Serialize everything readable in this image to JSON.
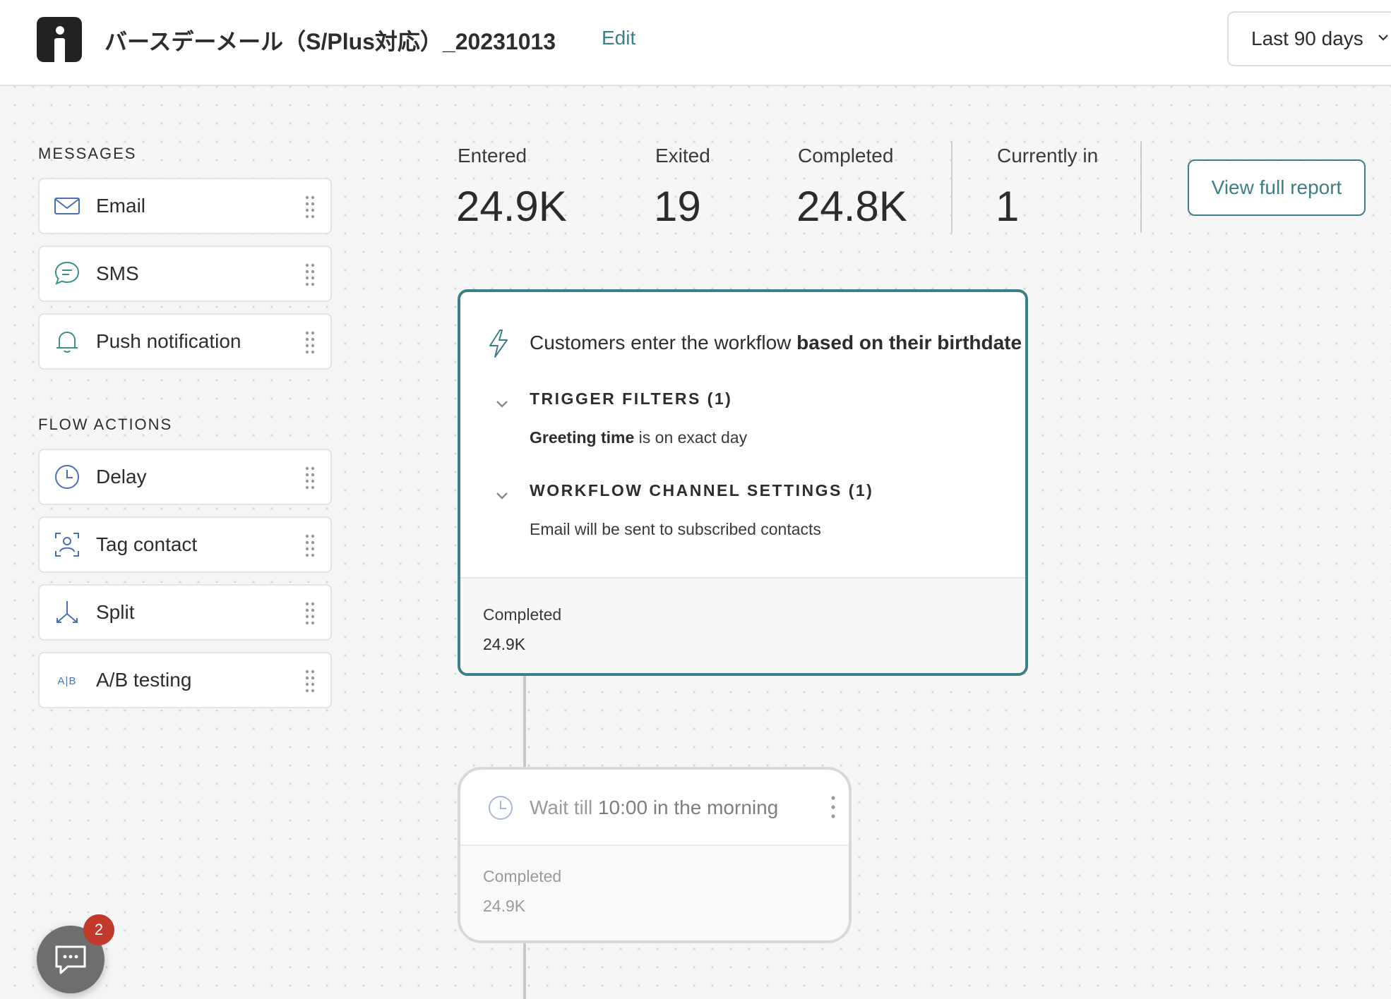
{
  "header": {
    "title": "バースデーメール（S/Plus対応）_20231013",
    "edit_label": "Edit",
    "date_range": "Last 90 days"
  },
  "palette": {
    "messages_title": "MESSAGES",
    "messages": [
      {
        "label": "Email",
        "icon": "envelope-icon"
      },
      {
        "label": "SMS",
        "icon": "chat-bubble-icon"
      },
      {
        "label": "Push notification",
        "icon": "bell-icon"
      }
    ],
    "actions_title": "FLOW ACTIONS",
    "actions": [
      {
        "label": "Delay",
        "icon": "clock-icon"
      },
      {
        "label": "Tag contact",
        "icon": "tag-contact-icon"
      },
      {
        "label": "Split",
        "icon": "split-icon"
      },
      {
        "label": "A/B testing",
        "icon": "ab-testing-icon",
        "icon_text": "A|B"
      }
    ]
  },
  "stats": {
    "entered_label": "Entered",
    "entered_value": "24.9K",
    "exited_label": "Exited",
    "exited_value": "19",
    "completed_label": "Completed",
    "completed_value": "24.8K",
    "current_label": "Currently in",
    "current_value": "1",
    "report_button": "View full report"
  },
  "trigger": {
    "text_prefix": "Customers enter the workflow ",
    "text_bold": "based on their birthdate",
    "filters_title": "TRIGGER FILTERS (1)",
    "filter_field": "Greeting time",
    "filter_rest": " is on exact day",
    "channel_title": "WORKFLOW CHANNEL SETTINGS (1)",
    "channel_text": "Email will be sent to subscribed contacts",
    "completed_label": "Completed",
    "completed_value": "24.9K"
  },
  "delay_step": {
    "text_prefix": "Wait till ",
    "text_bold": "10:00 in the morning",
    "completed_label": "Completed",
    "completed_value": "24.9K"
  },
  "chat": {
    "badge_count": "2"
  },
  "colors": {
    "accent": "#3d7f86",
    "icon_blue": "#4a6fb5",
    "badge": "#c0392b"
  }
}
